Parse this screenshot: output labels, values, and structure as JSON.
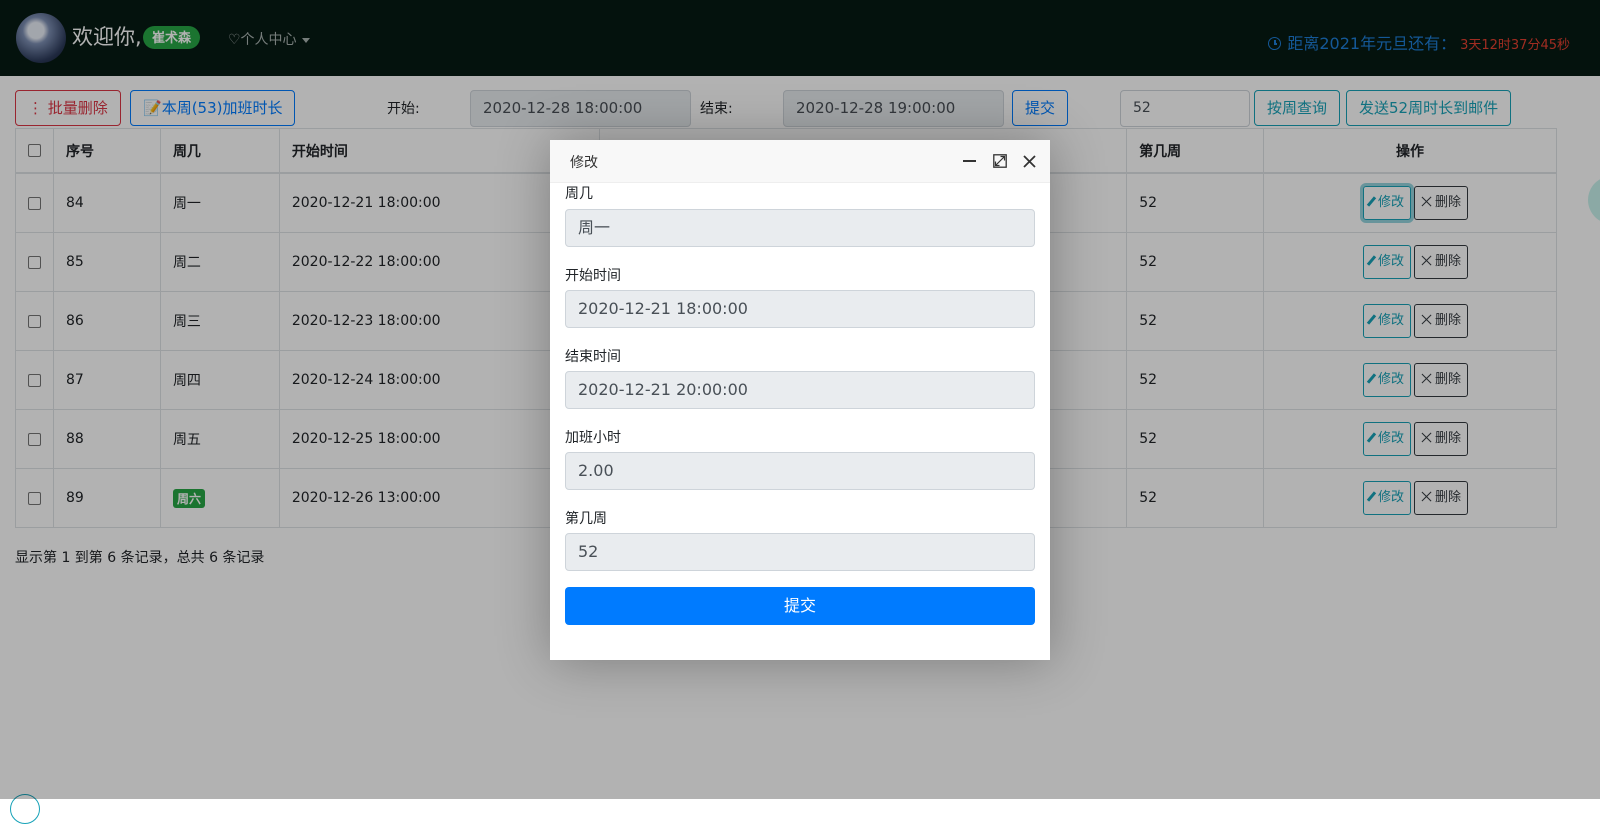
{
  "header": {
    "welcome": "欢迎你,",
    "username": "崔术森",
    "user_center": "♡个人中心",
    "countdown_label": "距离2021年元旦还有：",
    "countdown_value": "3天12时37分45秒"
  },
  "toolbar": {
    "batch_delete": "⋮ 批量删除",
    "week_overtime": "本周(53)加班时长",
    "start_label": "开始:",
    "start_value": "2020-12-28 18:00:00",
    "end_label": "结束:",
    "end_value": "2020-12-28 19:00:00",
    "submit": "提交",
    "week_value": "52",
    "query_by_week": "按周查询",
    "send_email": "发送52周时长到邮件"
  },
  "table": {
    "headers": [
      "序号",
      "周几",
      "开始时间",
      "第几周",
      "操作"
    ],
    "rows": [
      {
        "id": "84",
        "weekday": "周一",
        "start": "2020-12-21 18:00:00",
        "week": "52"
      },
      {
        "id": "85",
        "weekday": "周二",
        "start": "2020-12-22 18:00:00",
        "week": "52"
      },
      {
        "id": "86",
        "weekday": "周三",
        "start": "2020-12-23 18:00:00",
        "week": "52"
      },
      {
        "id": "87",
        "weekday": "周四",
        "start": "2020-12-24 18:00:00",
        "week": "52"
      },
      {
        "id": "88",
        "weekday": "周五",
        "start": "2020-12-25 18:00:00",
        "week": "52"
      },
      {
        "id": "89",
        "weekday": "周六",
        "start": "2020-12-26 13:00:00",
        "week": "52"
      }
    ],
    "edit_label": "修改",
    "delete_label": "删除",
    "pagination": "显示第 1 到第 6 条记录，总共 6 条记录"
  },
  "modal": {
    "title": "修改",
    "fields": [
      {
        "label": "周几",
        "value": "周一"
      },
      {
        "label": "开始时间",
        "value": "2020-12-21 18:00:00"
      },
      {
        "label": "结束时间",
        "value": "2020-12-21 20:00:00"
      },
      {
        "label": "加班小时",
        "value": "2.00"
      },
      {
        "label": "第几周",
        "value": "52"
      }
    ],
    "submit": "提交"
  },
  "colors": {
    "navbar": "#071a14",
    "primary": "#007bff",
    "success": "#28a745",
    "danger": "#dc3545",
    "info": "#17a2b8"
  },
  "icons": [
    "avatar",
    "heart-icon",
    "caret-down-icon",
    "clock-icon",
    "kebab-icon",
    "edit-doc-icon",
    "pencil-icon",
    "x-icon",
    "minimize-icon",
    "maximize-icon",
    "close-icon"
  ]
}
